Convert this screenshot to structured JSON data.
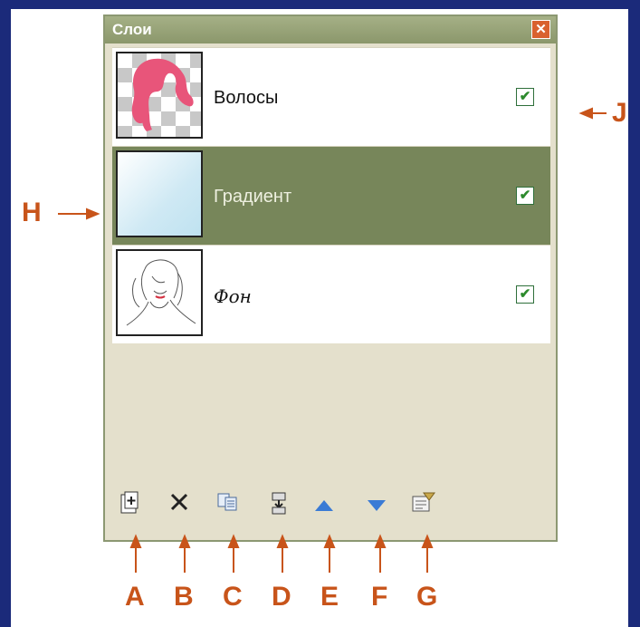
{
  "panel": {
    "title": "Слои",
    "close_symbol": "✕",
    "layers": [
      {
        "name": "Волосы",
        "visible": true,
        "selected": false,
        "thumbnail": "hair-silhouette-on-transparent"
      },
      {
        "name": "Градиент",
        "visible": true,
        "selected": true,
        "thumbnail": "light-blue-gradient"
      },
      {
        "name": "Фон",
        "visible": true,
        "selected": false,
        "thumbnail": "woman-line-sketch"
      }
    ],
    "checkbox_glyph": "✔",
    "toolbar": [
      {
        "icon": "add-layer-icon",
        "letter": "A"
      },
      {
        "icon": "delete-layer-icon",
        "letter": "B"
      },
      {
        "icon": "duplicate-layer-icon",
        "letter": "C"
      },
      {
        "icon": "merge-layer-down-icon",
        "letter": "D"
      },
      {
        "icon": "move-layer-up-icon",
        "letter": "E"
      },
      {
        "icon": "move-layer-down-icon",
        "letter": "F"
      },
      {
        "icon": "layer-properties-icon",
        "letter": "G"
      }
    ]
  },
  "callouts": {
    "selected_layer": "H",
    "visibility_checkbox": "J"
  },
  "colors": {
    "background": "#1b2a7a",
    "titlebar": "#8b976b",
    "selected_row": "#77865a",
    "callout": "#c8541a",
    "checkbox_mark": "#2c8a2c"
  }
}
